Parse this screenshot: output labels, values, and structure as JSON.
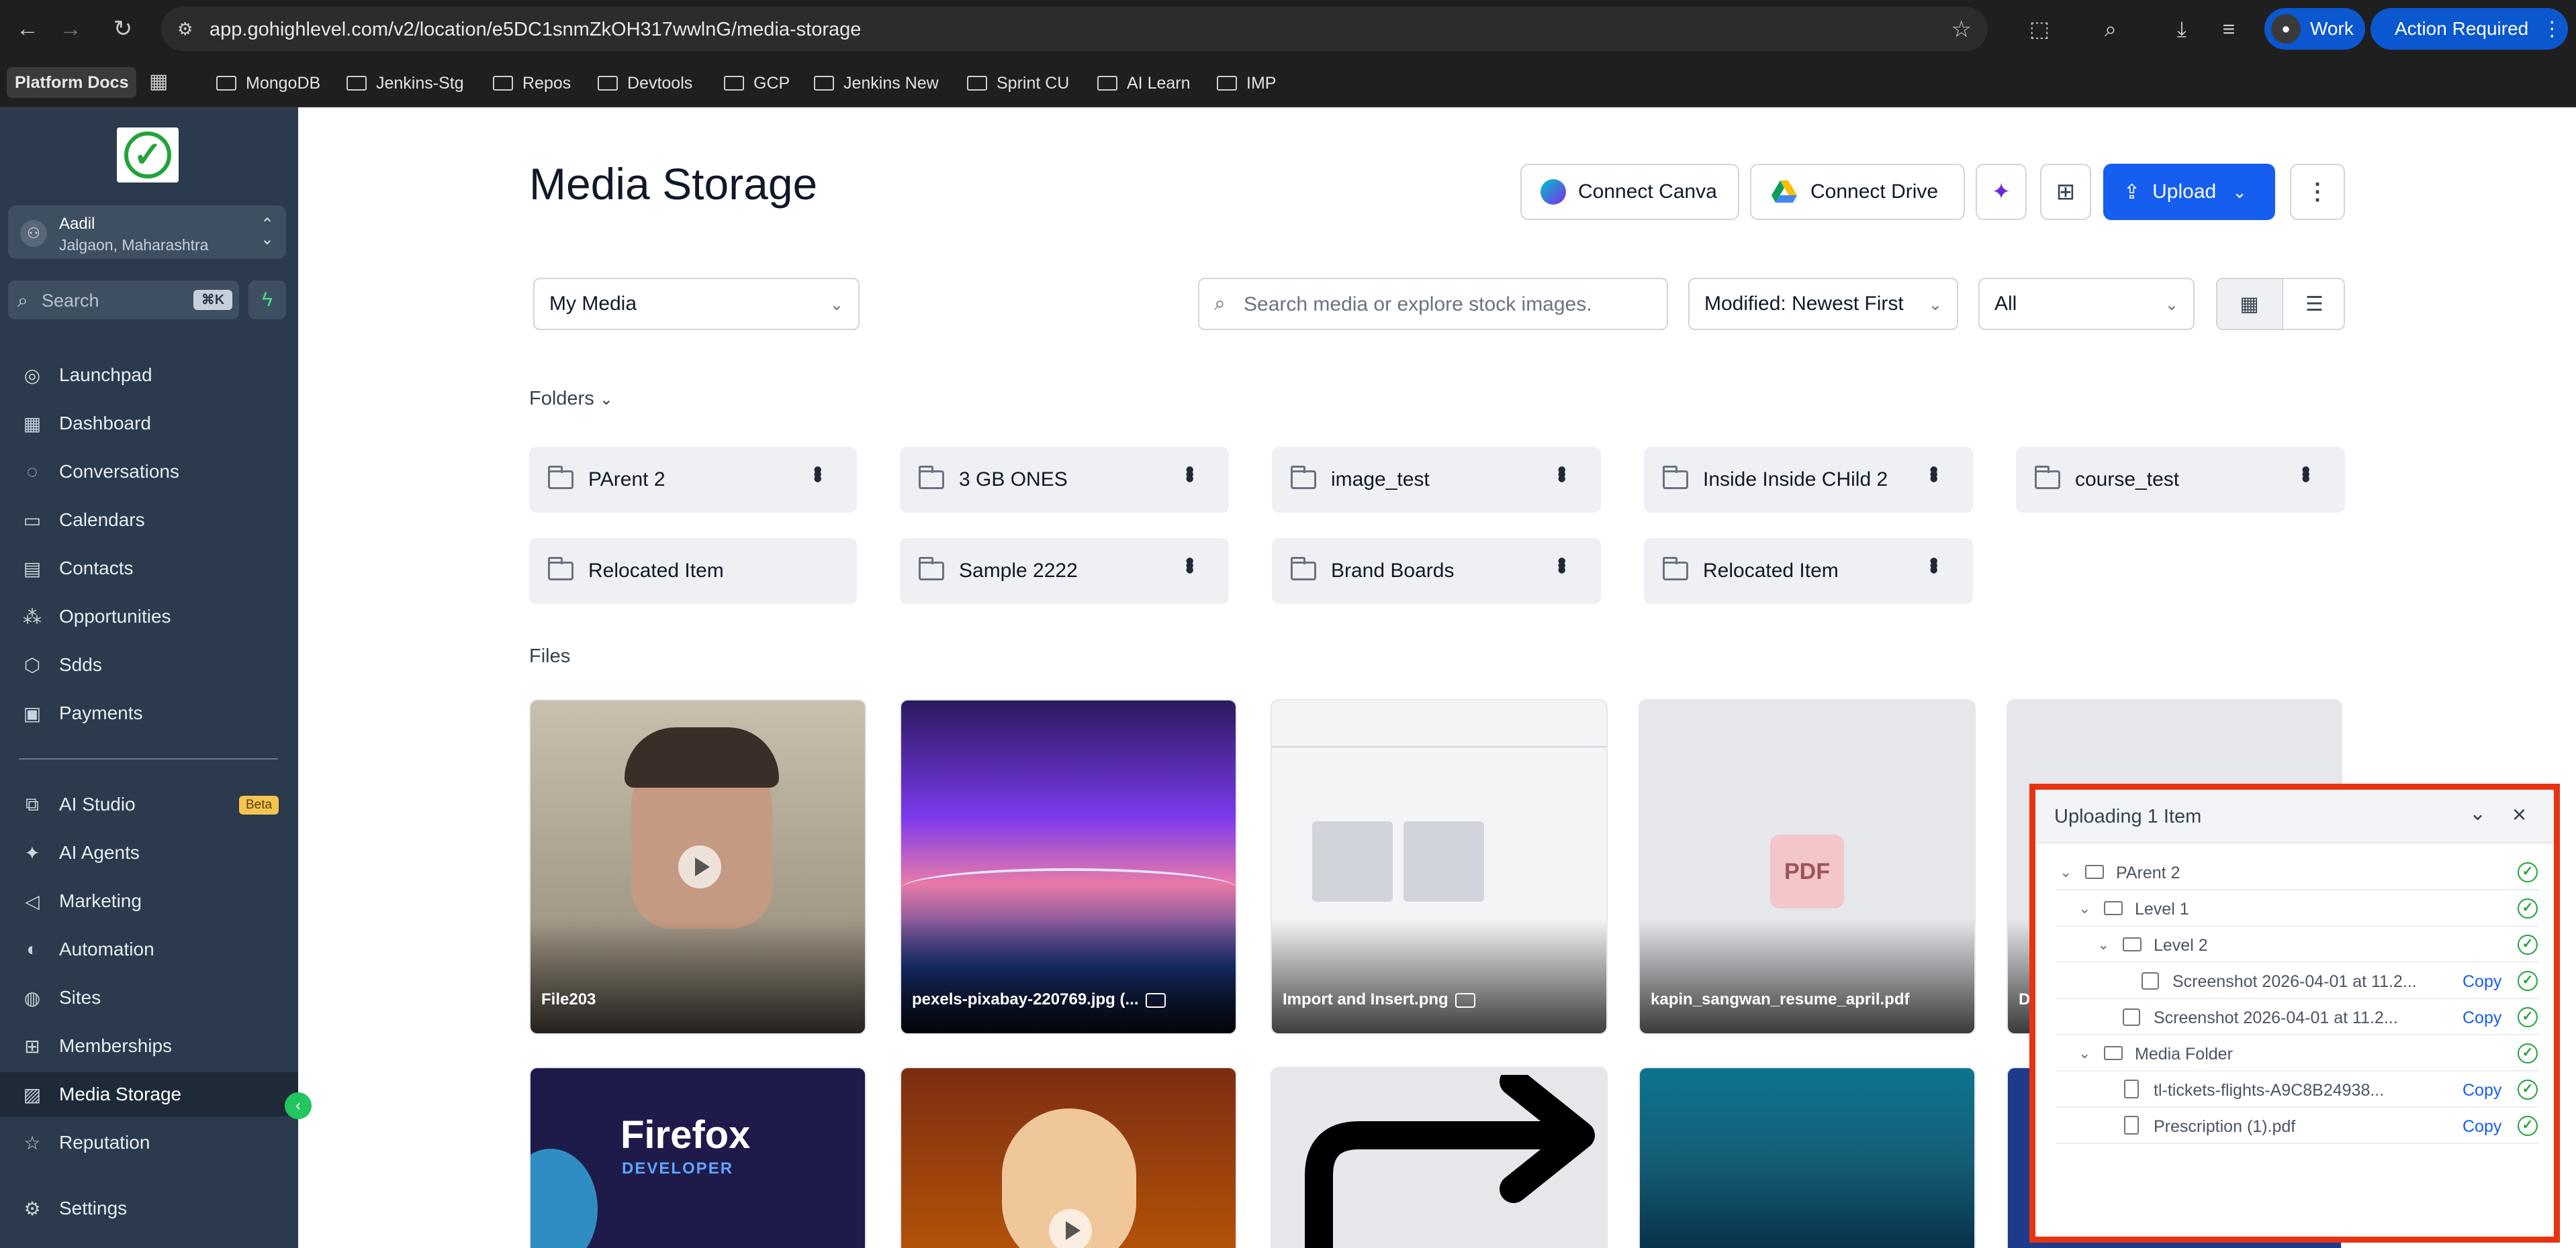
{
  "browser": {
    "url": "app.gohighlevel.com/v2/location/e5DC1snmZkOH317wwlnG/media-storage",
    "profile": "Work",
    "action_required": "Action Required",
    "bookmarks": [
      "Platform Docs",
      "MongoDB",
      "Jenkins-Stg",
      "Repos",
      "Devtools",
      "GCP",
      "Jenkins New",
      "Sprint CU",
      "AI Learn",
      "IMP"
    ]
  },
  "sidebar": {
    "account_name": "Aadil",
    "account_location": "Jalgaon, Maharashtra",
    "search_label": "Search",
    "search_shortcut": "⌘K",
    "items": [
      {
        "label": "Launchpad",
        "icon": "launchpad-icon"
      },
      {
        "label": "Dashboard",
        "icon": "dashboard-icon"
      },
      {
        "label": "Conversations",
        "icon": "chat-icon"
      },
      {
        "label": "Calendars",
        "icon": "calendar-icon"
      },
      {
        "label": "Contacts",
        "icon": "contacts-icon"
      },
      {
        "label": "Opportunities",
        "icon": "opportunities-icon"
      },
      {
        "label": "Sdds",
        "icon": "cube-icon"
      },
      {
        "label": "Payments",
        "icon": "payments-icon"
      },
      {
        "label": "AI Studio",
        "icon": "ai-studio-icon",
        "badge": "Beta"
      },
      {
        "label": "AI Agents",
        "icon": "ai-agents-icon"
      },
      {
        "label": "Marketing",
        "icon": "marketing-icon"
      },
      {
        "label": "Automation",
        "icon": "automation-icon"
      },
      {
        "label": "Sites",
        "icon": "globe-icon"
      },
      {
        "label": "Memberships",
        "icon": "memberships-icon"
      },
      {
        "label": "Media Storage",
        "icon": "image-icon",
        "active": true
      },
      {
        "label": "Reputation",
        "icon": "star-icon"
      },
      {
        "label": "Settings",
        "icon": "gear-icon"
      }
    ]
  },
  "header": {
    "title": "Media Storage",
    "connect_canva": "Connect Canva",
    "connect_drive": "Connect Drive",
    "upload": "Upload"
  },
  "filters": {
    "scope": "My Media",
    "search_placeholder": "Search media or explore stock images.",
    "sort": "Modified: Newest First",
    "type": "All"
  },
  "folders_label": "Folders",
  "folders": [
    "PArent 2",
    "3 GB ONES",
    "image_test",
    "Inside Inside CHild 2",
    "course_test",
    "Relocated Item",
    "Sample 2222",
    "Brand Boards",
    "Relocated Item"
  ],
  "files_label": "Files",
  "files": [
    {
      "name": "File203",
      "kind": "video"
    },
    {
      "name": "pexels-pixabay-220769.jpg (...",
      "kind": "image"
    },
    {
      "name": "Import and Insert.png",
      "kind": "image"
    },
    {
      "name": "kapin_sangwan_resume_april.pdf",
      "kind": "pdf"
    },
    {
      "name": "D",
      "kind": "other"
    }
  ],
  "second_row_texts": {
    "firefox_title": "Firefox",
    "firefox_sub": "DEVELOPER"
  },
  "upload_panel": {
    "title": "Uploading 1 Item",
    "copy_label": "Copy",
    "rows": [
      {
        "label": "PArent 2",
        "type": "folder",
        "depth": 0,
        "copy": false
      },
      {
        "label": "Level 1",
        "type": "folder",
        "depth": 1,
        "copy": false
      },
      {
        "label": "Level 2",
        "type": "folder",
        "depth": 2,
        "copy": false
      },
      {
        "label": "Screenshot 2026-04-01 at 11.2...",
        "type": "image",
        "depth": 3,
        "copy": true
      },
      {
        "label": "Screenshot 2026-04-01 at 11.2...",
        "type": "image",
        "depth": 2,
        "copy": true
      },
      {
        "label": "Media Folder",
        "type": "folder",
        "depth": 1,
        "copy": false
      },
      {
        "label": "tl-tickets-flights-A9C8B24938...",
        "type": "doc",
        "depth": 2,
        "copy": true
      },
      {
        "label": "Prescription (1).pdf",
        "type": "doc",
        "depth": 2,
        "copy": true
      }
    ]
  },
  "colors": {
    "sidebar": "#2b3a4c",
    "accent": "#155eef",
    "success": "#22a33b",
    "highlight_border": "#e63312"
  }
}
